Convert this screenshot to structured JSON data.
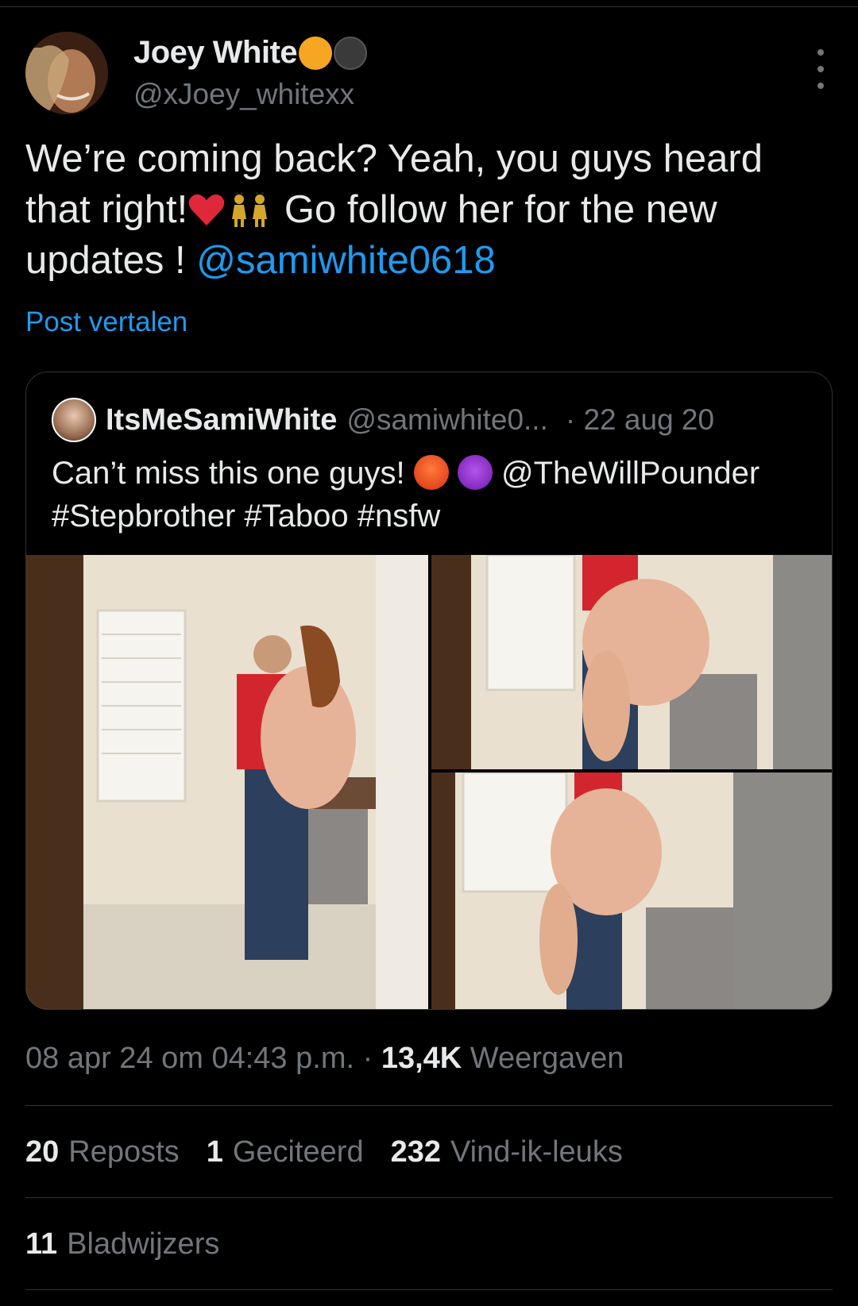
{
  "author": {
    "display_name": "Joey White",
    "handle": "@xJoey_whitexx",
    "badges": [
      "orange-circle-icon",
      "black-circle-icon"
    ]
  },
  "tweet": {
    "text_part1": "We’re coming back? Yeah, you guys heard that right!",
    "text_part2": " Go follow her for the new updates ! ",
    "mention": "@samiwhite0618",
    "emojis": [
      "red-heart-icon",
      "dancers-icon"
    ],
    "translate_label": "Post vertalen"
  },
  "quoted": {
    "display_name": "ItsMeSamiWhite",
    "handle": "@samiwhite0...",
    "date": "· 22 aug 20",
    "text_part1": "Can’t miss this one guys! ",
    "emojis": [
      "hot-face-icon",
      "smiling-devil-icon"
    ],
    "mention": " @TheWillPounder",
    "hashtags": "#Stepbrother #Taboo #nsfw",
    "media": [
      "photo-1",
      "photo-2",
      "photo-3"
    ]
  },
  "meta": {
    "timestamp": "08 apr 24 om 04:43 p.m. · ",
    "views_count": "13,4K",
    "views_label": " Weergaven"
  },
  "stats": {
    "reposts_count": "20",
    "reposts_label": "Reposts",
    "quotes_count": "1",
    "quotes_label": "Geciteerd",
    "likes_count": "232",
    "likes_label": "Vind-ik-leuks",
    "bookmarks_count": "11",
    "bookmarks_label": "Bladwijzers"
  },
  "colors": {
    "background": "#000000",
    "text": "#e7e9ea",
    "secondary": "#71767b",
    "link": "#1d9bf0",
    "border": "#2f3336"
  }
}
